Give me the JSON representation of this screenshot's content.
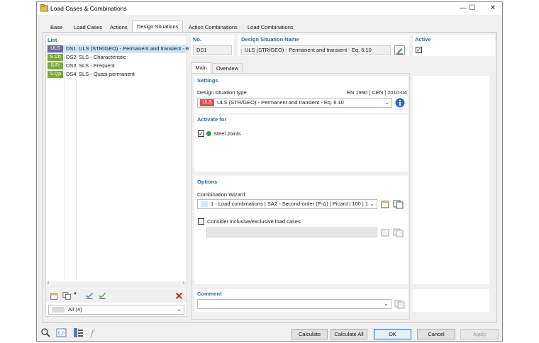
{
  "window": {
    "title": "Load Cases & Combinations",
    "min": "—",
    "max": "☐",
    "close": "✕"
  },
  "tabs": [
    {
      "label": "Base"
    },
    {
      "label": "Load Cases"
    },
    {
      "label": "Actions"
    },
    {
      "label": "Design Situations"
    },
    {
      "label": "Action Combinations"
    },
    {
      "label": "Load Combinations"
    }
  ],
  "list": {
    "title": "List",
    "items": [
      {
        "badge": "ULS",
        "badge_color": "#6b6a9e",
        "code": "DS1",
        "name": "ULS (STR/GEO) - Permanent and transient - E"
      },
      {
        "badge": "S Ch",
        "badge_color": "#7aa83b",
        "code": "DS2",
        "name": "SLS - Characteristic"
      },
      {
        "badge": "S Fr",
        "badge_color": "#7aa83b",
        "code": "DS3",
        "name": "SLS - Frequent"
      },
      {
        "badge": "S Qp",
        "badge_color": "#7aa83b",
        "code": "DS4",
        "name": "SLS - Quasi-permanent"
      }
    ],
    "filter": "All (4)"
  },
  "header": {
    "no_label": "No.",
    "no_value": "DS1",
    "name_label": "Design Situation Name",
    "name_value": "ULS (STR/GEO) - Permanent and transient - Eq. 6.10",
    "active_label": "Active",
    "active_checked": "✓"
  },
  "subtabs": [
    {
      "label": "Main"
    },
    {
      "label": "Overview"
    }
  ],
  "settings": {
    "title": "Settings",
    "type_label": "Design situation type",
    "standard": "EN 1990 | CEN | 2010-04",
    "type_badge": "ULS",
    "type_badge_color": "#d9534f",
    "type_value": "ULS (STR/GEO) - Permanent and transient - Eq. 6.10"
  },
  "activate": {
    "title": "Activate for",
    "item_label": "Steel Joints",
    "item_checked": "✓",
    "dot_color": "#2aa32a",
    "arrow_color": "#1f3fd1"
  },
  "options": {
    "title": "Options",
    "wizard_label": "Combination Wizard",
    "wizard_value": "1 - Load combinations | SA2 - Second-order (P-Δ) | Picard | 100 | 1",
    "inclusive_label": "Consider inclusive/exclusive load cases"
  },
  "comment": {
    "title": "Comment"
  },
  "buttons": {
    "calculate": "Calculate",
    "calculate_all": "Calculate All",
    "ok": "OK",
    "cancel": "Cancel",
    "apply": "Apply"
  }
}
